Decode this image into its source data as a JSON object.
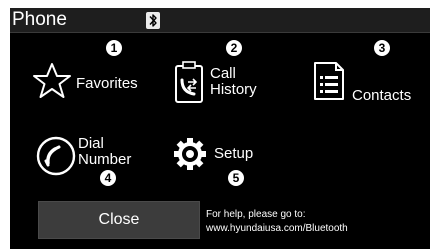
{
  "app": {
    "title": "Phone"
  },
  "menu": [
    {
      "number": "1",
      "label": "Favorites"
    },
    {
      "number": "2",
      "label_line1": "Call",
      "label_line2": "History"
    },
    {
      "number": "3",
      "label": "Contacts"
    },
    {
      "number": "4",
      "label_line1": "Dial",
      "label_line2": "Number"
    },
    {
      "number": "5",
      "label": "Setup"
    }
  ],
  "close_label": "Close",
  "help": {
    "line1": "For help, please go to:",
    "line2": "www.hyundaiusa.com/Bluetooth"
  },
  "icons": {
    "status": "bluetooth-icon",
    "favorites": "star-icon",
    "call_history": "call-history-icon",
    "contacts": "contacts-icon",
    "dial_number": "phone-handset-icon",
    "setup": "gear-icon"
  },
  "colors": {
    "screen_bg": "#000000",
    "text": "#ffffff",
    "button_bg": "#3c3c3c"
  }
}
